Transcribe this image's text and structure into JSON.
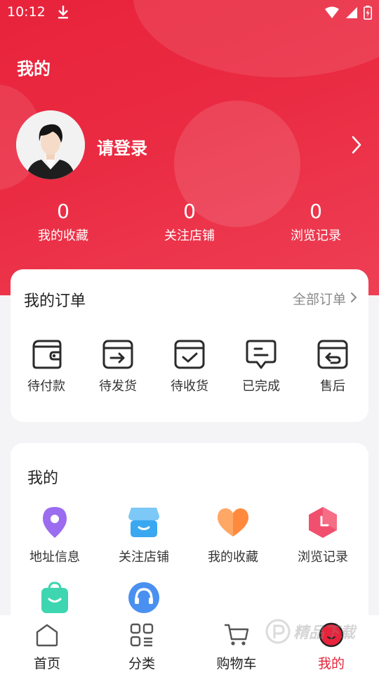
{
  "status": {
    "time": "10:12"
  },
  "header": {
    "title": "我的"
  },
  "profile": {
    "login_label": "请登录"
  },
  "stats": [
    {
      "value": "0",
      "label": "我的收藏"
    },
    {
      "value": "0",
      "label": "关注店铺"
    },
    {
      "value": "0",
      "label": "浏览记录"
    }
  ],
  "orders": {
    "title": "我的订单",
    "all_label": "全部订单",
    "items": [
      {
        "label": "待付款",
        "icon": "wallet-icon"
      },
      {
        "label": "待发货",
        "icon": "box-arrow-icon"
      },
      {
        "label": "待收货",
        "icon": "box-check-icon"
      },
      {
        "label": "已完成",
        "icon": "chat-done-icon"
      },
      {
        "label": "售后",
        "icon": "box-return-icon"
      }
    ]
  },
  "mine": {
    "title": "我的",
    "items": [
      {
        "label": "地址信息",
        "icon": "location-pin-icon",
        "color": "#9b6cf0"
      },
      {
        "label": "关注店铺",
        "icon": "store-icon",
        "color": "#3aa8f0"
      },
      {
        "label": "我的收藏",
        "icon": "heart-icon",
        "color": "#ff8a3d"
      },
      {
        "label": "浏览记录",
        "icon": "clock-icon",
        "color": "#f0506e"
      },
      {
        "label": "",
        "icon": "shopping-bag-icon",
        "color": "#3ed6b0"
      },
      {
        "label": "",
        "icon": "headset-icon",
        "color": "#4a90f0"
      }
    ]
  },
  "tabs": [
    {
      "label": "首页",
      "icon": "home-icon"
    },
    {
      "label": "分类",
      "icon": "category-icon"
    },
    {
      "label": "购物车",
      "icon": "cart-icon"
    },
    {
      "label": "我的",
      "icon": "profile-icon"
    }
  ],
  "colors": {
    "brand": "#e8233b",
    "tab_active": "#e8233b"
  }
}
